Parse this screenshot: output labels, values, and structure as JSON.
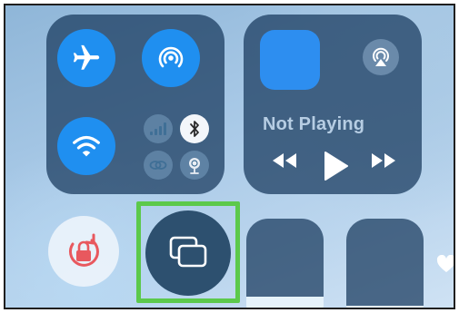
{
  "control_center": {
    "connectivity": {
      "airplane_mode": {
        "icon": "airplane-icon",
        "active": true
      },
      "airdrop": {
        "icon": "airdrop-icon",
        "active": true
      },
      "wifi": {
        "icon": "wifi-icon",
        "active": true
      },
      "cellular": {
        "icon": "cellular-signal-icon",
        "active": false
      },
      "bluetooth": {
        "icon": "bluetooth-icon",
        "active": true
      },
      "personal_link": {
        "icon": "link-icon",
        "active": false
      },
      "hotspot": {
        "icon": "hotspot-icon",
        "active": false
      }
    },
    "media": {
      "status_text": "Not Playing",
      "airplay_icon": "airplay-icon",
      "controls": [
        "rewind-icon",
        "play-icon",
        "fast-forward-icon"
      ]
    },
    "orientation_lock": {
      "icon": "orientation-lock-icon",
      "active": true
    },
    "screen_mirroring": {
      "icon": "screen-mirroring-icon",
      "highlighted": true
    },
    "brightness_slider": {
      "level": 0.28
    },
    "volume_slider": {
      "level": 0.2
    },
    "favorites_icon": "heart-icon"
  },
  "colors": {
    "accent_blue": "#1f8ff0",
    "highlight_green": "#5cc94b",
    "lock_red": "#e8585e"
  }
}
